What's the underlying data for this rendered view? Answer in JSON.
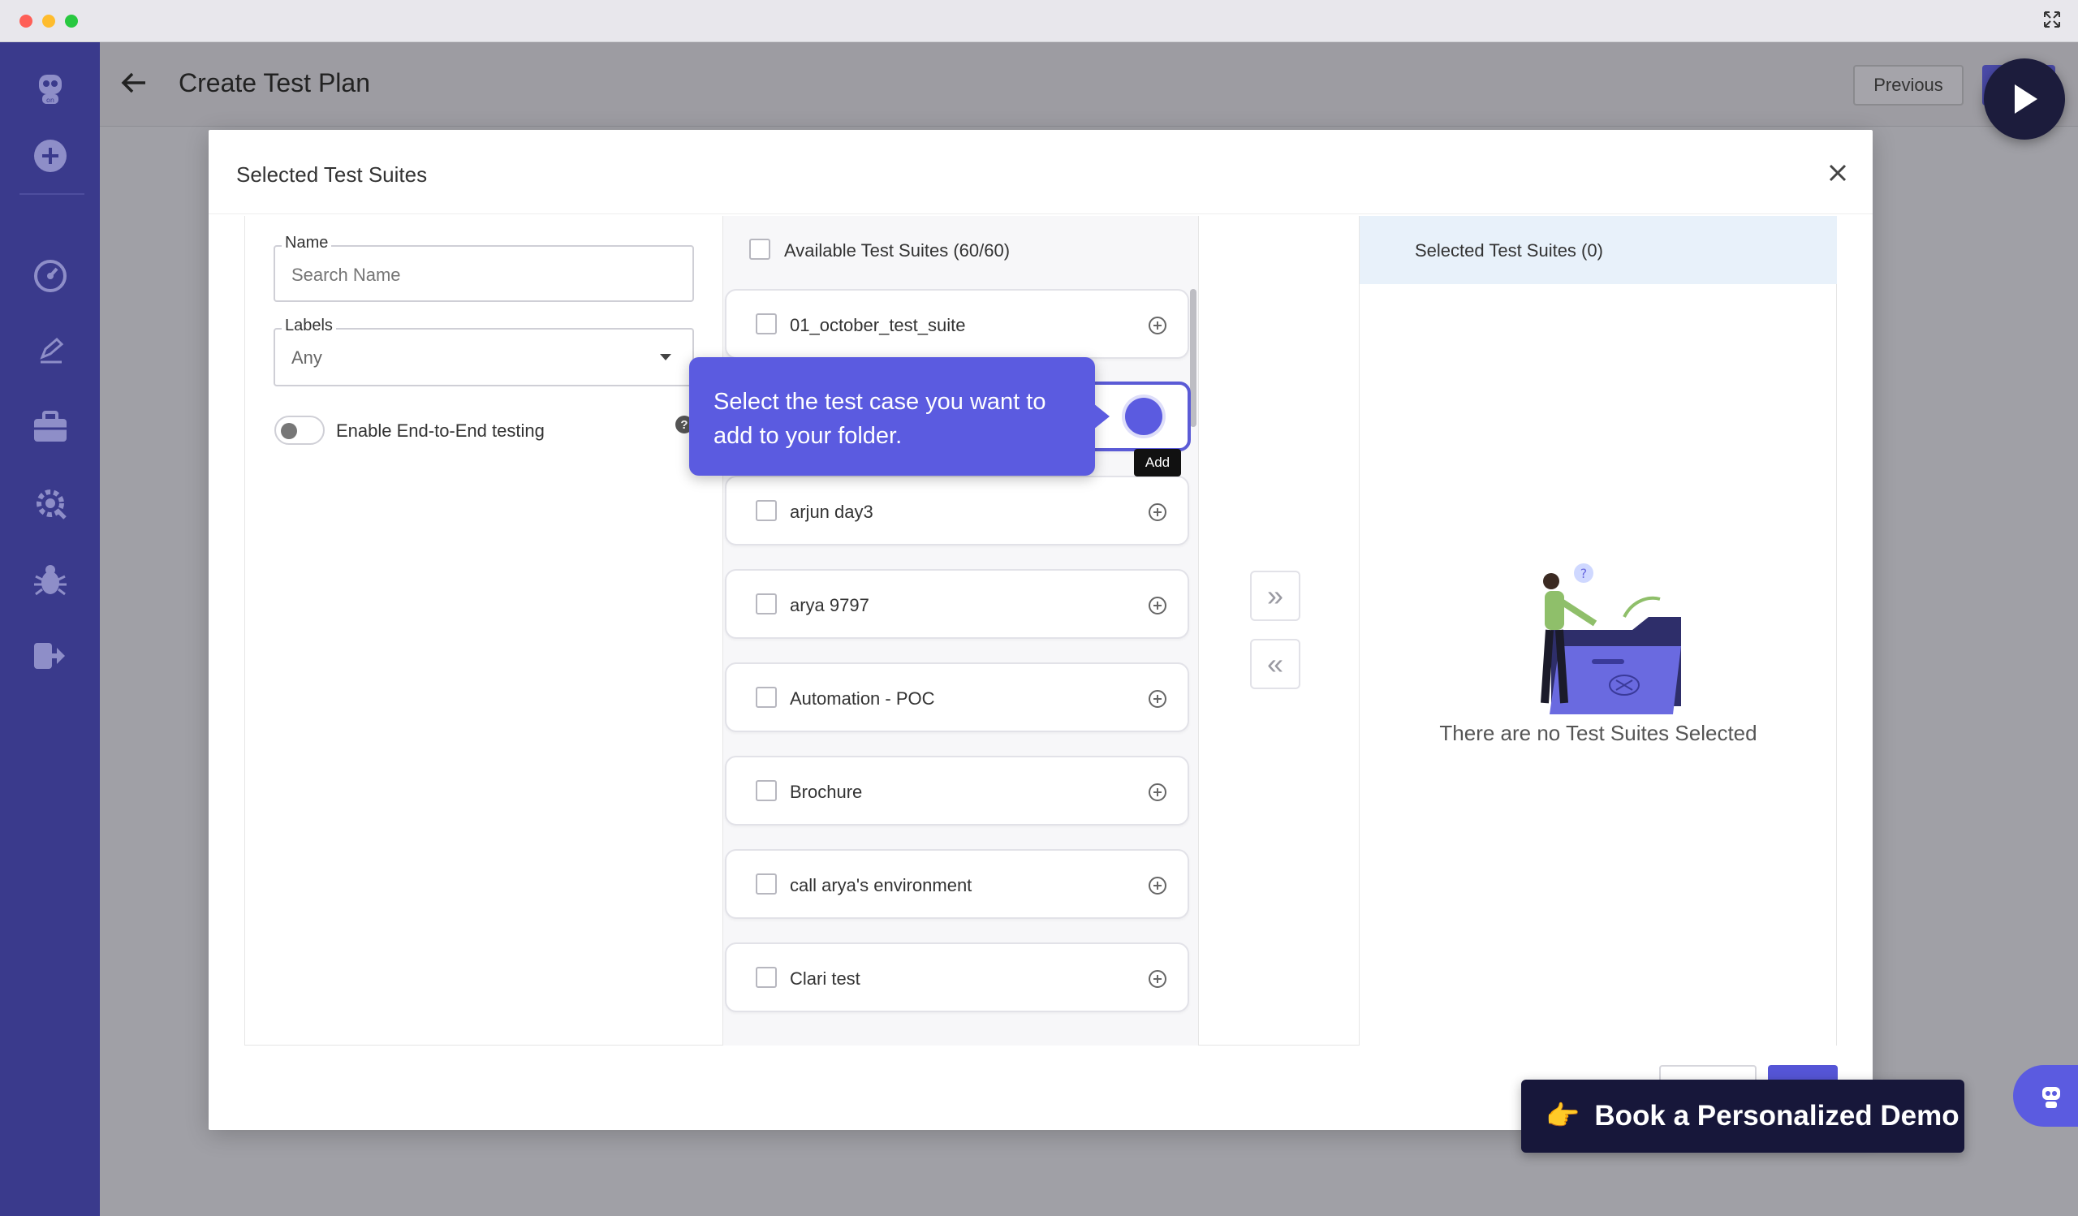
{
  "window": {
    "expand_icon": "expand-icon"
  },
  "sidebar": {
    "items": [
      {
        "name": "robot-logo-icon"
      },
      {
        "name": "add-circle-icon"
      },
      {
        "name": "dashboard-gauge-icon"
      },
      {
        "name": "edit-pencil-icon"
      },
      {
        "name": "briefcase-icon"
      },
      {
        "name": "settings-gear-icon"
      },
      {
        "name": "bug-icon"
      },
      {
        "name": "logout-icon"
      }
    ]
  },
  "header": {
    "title": "Create Test Plan",
    "previous_label": "Previous"
  },
  "modal": {
    "title": "Selected Test Suites",
    "filters": {
      "name_legend": "Name",
      "name_placeholder": "Search Name",
      "labels_legend": "Labels",
      "labels_value": "Any",
      "e2e_label": "Enable End-to-End testing",
      "help_glyph": "?"
    },
    "available": {
      "title": "Available Test Suites (60/60)",
      "items": [
        {
          "label": "01_october_test_suite"
        },
        {
          "label": ""
        },
        {
          "label": "arjun day3"
        },
        {
          "label": "arya 9797"
        },
        {
          "label": "Automation - POC"
        },
        {
          "label": "Brochure"
        },
        {
          "label": "call arya's environment"
        },
        {
          "label": "Clari test"
        }
      ]
    },
    "transfer": {
      "move_all_right": "»",
      "move_all_left": "«"
    },
    "selected": {
      "title": "Selected Test Suites (0)",
      "empty_text": "There are no Test Suites Selected"
    }
  },
  "tour": {
    "text": "Select the test case you want to add to your folder.",
    "tooltip": "Add"
  },
  "cta": {
    "emoji": "👉",
    "label": "Book a Personalized Demo"
  },
  "colors": {
    "sidebar": "#3a3a8c",
    "accent": "#5b5be0",
    "cta_bg": "#17173a",
    "selected_header": "#e8f1fa"
  }
}
